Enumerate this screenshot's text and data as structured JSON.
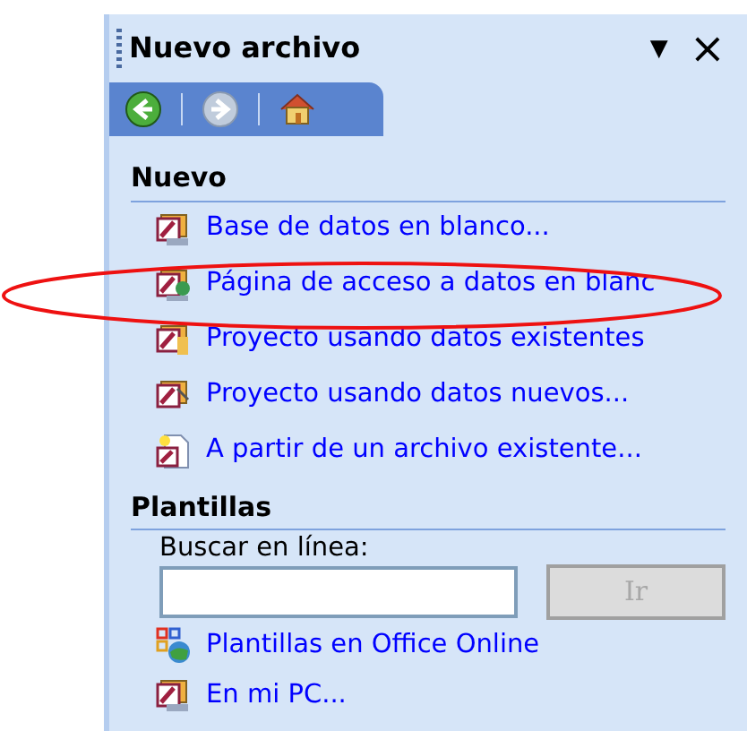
{
  "panel": {
    "title": "Nuevo archivo",
    "menu_glyph": "▼",
    "close_glyph": "×"
  },
  "nav": [
    {
      "kind": "back",
      "disabled": false
    },
    {
      "kind": "forward",
      "disabled": true
    },
    {
      "kind": "home",
      "disabled": false
    }
  ],
  "sections": [
    {
      "title": "Nuevo",
      "items": [
        {
          "kind": "database",
          "label": "Base de datos en blanco..."
        },
        {
          "kind": "page",
          "label": "Página de acceso a datos en blanc"
        },
        {
          "kind": "project-existing",
          "label": "Proyecto usando datos existentes"
        },
        {
          "kind": "project-new",
          "label": "Proyecto usando datos nuevos..."
        },
        {
          "kind": "from-file",
          "label": "A partir de un archivo existente..."
        }
      ]
    },
    {
      "title": "Plantillas",
      "search": {
        "label": "Buscar en línea:",
        "button": "Ir",
        "disabled": true
      },
      "items": [
        {
          "kind": "online",
          "label": "Plantillas en Office Online"
        },
        {
          "kind": "database",
          "label": "En mi PC..."
        }
      ]
    }
  ],
  "annotation": {
    "kind": "ellipse",
    "color": "#ee1111"
  }
}
